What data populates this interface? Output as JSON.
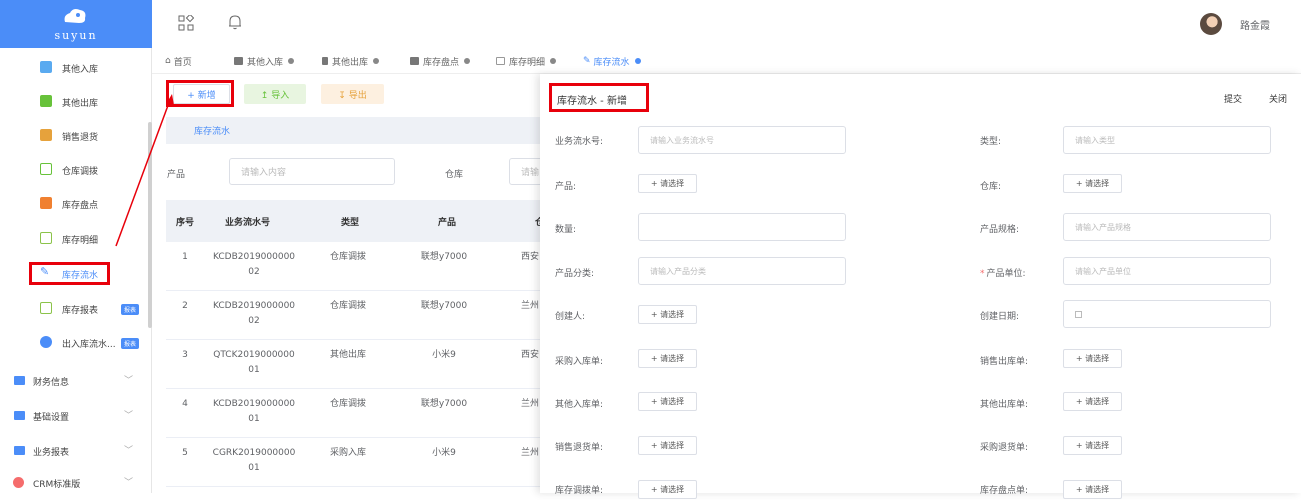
{
  "logo": {
    "text": "suyun"
  },
  "sidebar": {
    "items": [
      {
        "label": "其他入库",
        "color": "#5aaaf0"
      },
      {
        "label": "其他出库",
        "color": "#67c23a"
      },
      {
        "label": "销售退货",
        "color": "#e6a23c"
      },
      {
        "label": "仓库调拨",
        "color": "#67c23a"
      },
      {
        "label": "库存盘点",
        "color": "#f08030"
      },
      {
        "label": "库存明细",
        "color": "#8bc34a"
      },
      {
        "label": "库存流水",
        "color": "#4b8df8",
        "active": true
      },
      {
        "label": "库存报表",
        "color": "#8bc34a",
        "badge": "报表"
      },
      {
        "label": "出入库流水...",
        "color": "#4b8df8",
        "badge": "报表"
      }
    ],
    "groups": [
      {
        "label": "财务信息"
      },
      {
        "label": "基础设置"
      },
      {
        "label": "业务报表"
      },
      {
        "label": "CRM标准版"
      }
    ]
  },
  "header": {
    "user_name": "路金霞"
  },
  "tabs": [
    {
      "label": "首页"
    },
    {
      "label": "其他入库"
    },
    {
      "label": "其他出库"
    },
    {
      "label": "库存盘点"
    },
    {
      "label": "库存明细"
    },
    {
      "label": "库存流水",
      "active": true
    }
  ],
  "toolbar": {
    "add_label": "+ 新增",
    "import_label": "↥ 导入",
    "export_label": "↧ 导出"
  },
  "section": {
    "title": "库存流水"
  },
  "filters": {
    "product_label": "产品",
    "product_placeholder": "请输入内容",
    "warehouse_label": "仓库",
    "warehouse_placeholder": "请输"
  },
  "table": {
    "headers": [
      "序号",
      "业务流水号",
      "类型",
      "产品",
      "仓"
    ],
    "rows": [
      {
        "no": "1",
        "code": "KCDB2019000000",
        "code2": "02",
        "type": "仓库调拨",
        "product": "联想y7000",
        "wh": "西安"
      },
      {
        "no": "2",
        "code": "KCDB2019000000",
        "code2": "02",
        "type": "仓库调拨",
        "product": "联想y7000",
        "wh": "兰州"
      },
      {
        "no": "3",
        "code": "QTCK2019000000",
        "code2": "01",
        "type": "其他出库",
        "product": "小米9",
        "wh": "西安"
      },
      {
        "no": "4",
        "code": "KCDB2019000000",
        "code2": "01",
        "type": "仓库调拨",
        "product": "联想y7000",
        "wh": "兰州"
      },
      {
        "no": "5",
        "code": "CGRK2019000000",
        "code2": "01",
        "type": "采购入库",
        "product": "小米9",
        "wh": "兰州"
      }
    ]
  },
  "drawer": {
    "title": "库存流水 - 新增",
    "submit_label": "提交",
    "close_label": "关闭",
    "fields": {
      "serial_label": "业务流水号:",
      "serial_placeholder": "请输入业务流水号",
      "type_label": "类型:",
      "type_placeholder": "请输入类型",
      "product_label": "产品:",
      "product_select": "+ 请选择",
      "warehouse_label": "仓库:",
      "warehouse_select": "+ 请选择",
      "qty_label": "数量:",
      "spec_label": "产品规格:",
      "spec_placeholder": "请输入产品规格",
      "category_label": "产品分类:",
      "category_placeholder": "请输入产品分类",
      "unit_label": "产品单位:",
      "unit_placeholder": "请输入产品单位",
      "creator_label": "创建人:",
      "creator_select": "+ 请选择",
      "date_label": "创建日期:",
      "purchase_in_label": "采购入库单:",
      "purchase_in_select": "+ 请选择",
      "sales_out_label": "销售出库单:",
      "sales_out_select": "+ 请选择",
      "other_in_label": "其他入库单:",
      "other_in_select": "+ 请选择",
      "other_out_label": "其他出库单:",
      "other_out_select": "+ 请选择",
      "sales_return_label": "销售退货单:",
      "sales_return_select": "+ 请选择",
      "purchase_return_label": "采购退货单:",
      "purchase_return_select": "+ 请选择",
      "transfer_label": "库存调拨单:",
      "transfer_select": "+ 请选择",
      "stocktake_label": "库存盘点单:",
      "stocktake_select": "+ 请选择"
    }
  },
  "colors": {
    "accent": "#4b8df8",
    "annotation": "#e8000b"
  }
}
